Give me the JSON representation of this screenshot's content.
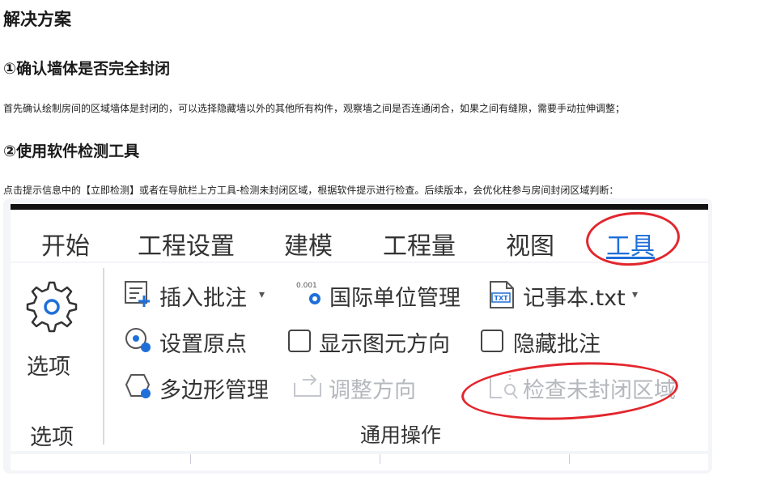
{
  "article": {
    "title": "解决方案",
    "section1_title": "①确认墙体是否完全封闭",
    "section1_text": "首先确认绘制房间的区域墙体是封闭的，可以选择隐藏墙以外的其他所有构件，观察墙之间是否连通闭合，如果之间有缝隙，需要手动拉伸调整；",
    "section2_title": "②使用软件检测工具",
    "section2_text": "点击提示信息中的【立即检测】或者在导航栏上方工具-检测未封闭区域，根据软件提示进行检查。后续版本，会优化柱参与房间封闭区域判断："
  },
  "ribbon": {
    "tabs": [
      "开始",
      "工程设置",
      "建模",
      "工程量",
      "视图",
      "工具"
    ],
    "active_tab": "工具",
    "options_button": "选项",
    "options_group": "选项",
    "insert_note": "插入批注",
    "intl_unit_icon_text": "0.001",
    "intl_unit": "国际单位管理",
    "notepad_icon_text": "TXT",
    "notepad": "记事本.txt",
    "set_origin": "设置原点",
    "show_direction": "显示图元方向",
    "hide_note": "隐藏批注",
    "polygon_manage": "多边形管理",
    "adjust_direction": "调整方向",
    "check_unclosed": "检查未封闭区域",
    "general_group": "通用操作"
  },
  "colors": {
    "accent": "#1e6fd9",
    "highlight": "#e3262d",
    "disabled": "#b5b8bd"
  }
}
